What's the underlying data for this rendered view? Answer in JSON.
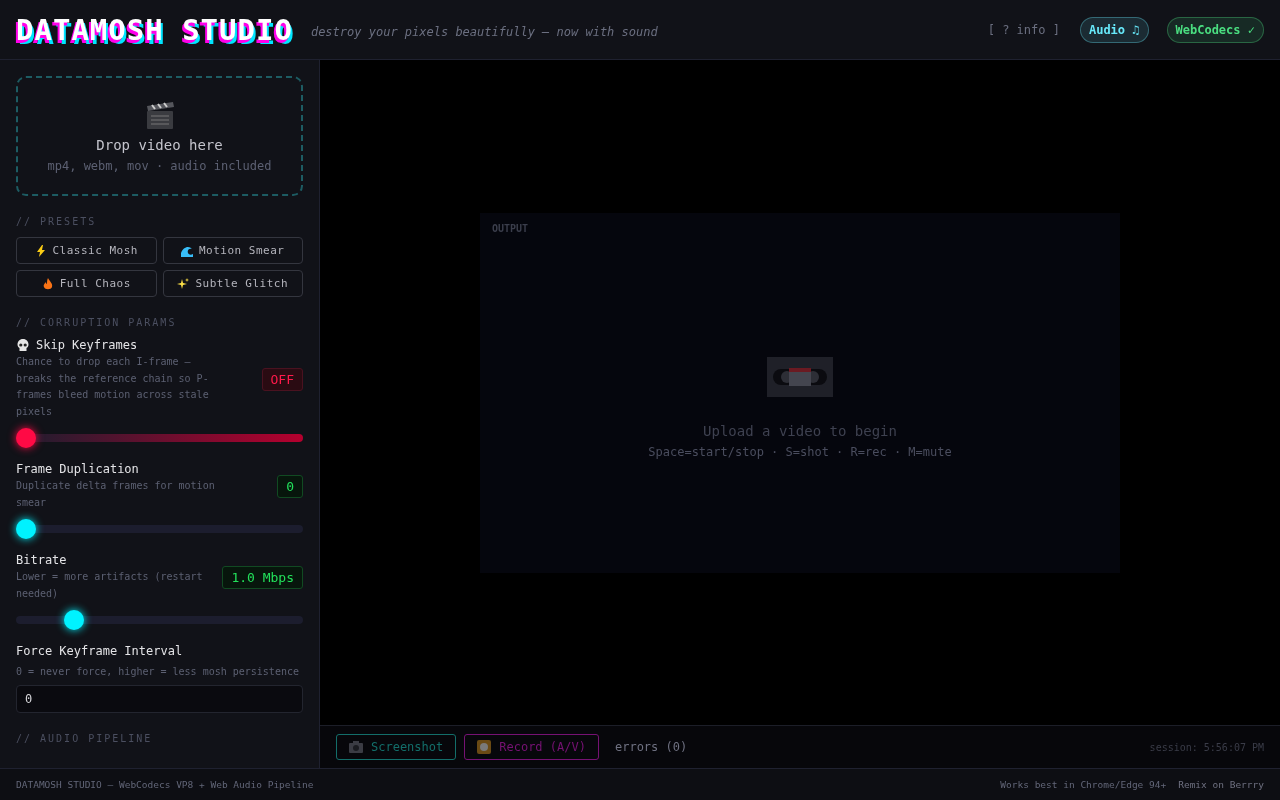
{
  "header": {
    "title": "DATAMOSH STUDIO",
    "tagline": "destroy your pixels beautifully — now with sound",
    "info_link": "[ ? info ]",
    "badges": [
      {
        "label": "Audio ♫",
        "color": "#67e8f9"
      },
      {
        "label": "WebCodecs ✓",
        "color": "#4ade80"
      }
    ]
  },
  "dropzone": {
    "title": "Drop video here",
    "hint": "mp4, webm, mov · audio included"
  },
  "presets": {
    "heading": "// PRESETS",
    "items": [
      {
        "label": "Classic Mosh",
        "kind": "bolt"
      },
      {
        "label": "Motion Smear",
        "kind": "wave"
      },
      {
        "label": "Full Chaos",
        "kind": "fire"
      },
      {
        "label": "Subtle Glitch",
        "kind": "sparkle"
      }
    ]
  },
  "params": {
    "heading": "// CORRUPTION PARAMS",
    "items": [
      {
        "kind": "chance",
        "name": "Skip Keyframes",
        "description": "Chance to drop each I-frame — breaks the reference chain so P-frames bleed motion across stale pixels",
        "reading": "OFF",
        "level": 0
      },
      {
        "kind": "slider",
        "name": "Frame Duplication",
        "description": "Duplicate delta frames for motion smear",
        "reading": "0",
        "level": 0
      },
      {
        "kind": "slider",
        "name": "Bitrate",
        "description": "Lower = more artifacts (restart needed)",
        "reading": "1.0 Mbps",
        "level": 0.18
      },
      {
        "kind": "number",
        "name": "Force Keyframe Interval",
        "description": "0 = never force, higher = less mosh persistence",
        "value": "0"
      }
    ]
  },
  "audio": {
    "heading": "// AUDIO PIPELINE"
  },
  "output": {
    "label": "OUTPUT",
    "message": "Upload a video to begin",
    "shortcuts": "Space=start/stop · S=shot · R=rec · M=mute"
  },
  "toolbar": {
    "screenshot": "Screenshot",
    "record": "Record (A/V)",
    "errors": "errors (0)",
    "session": "session: 5:56:07 PM"
  },
  "footer": {
    "left": "DATAMOSH STUDIO — WebCodecs VP8 + Web Audio Pipeline",
    "note": "Works best in Chrome/Edge 94+",
    "link": "Remix on Berrry"
  }
}
